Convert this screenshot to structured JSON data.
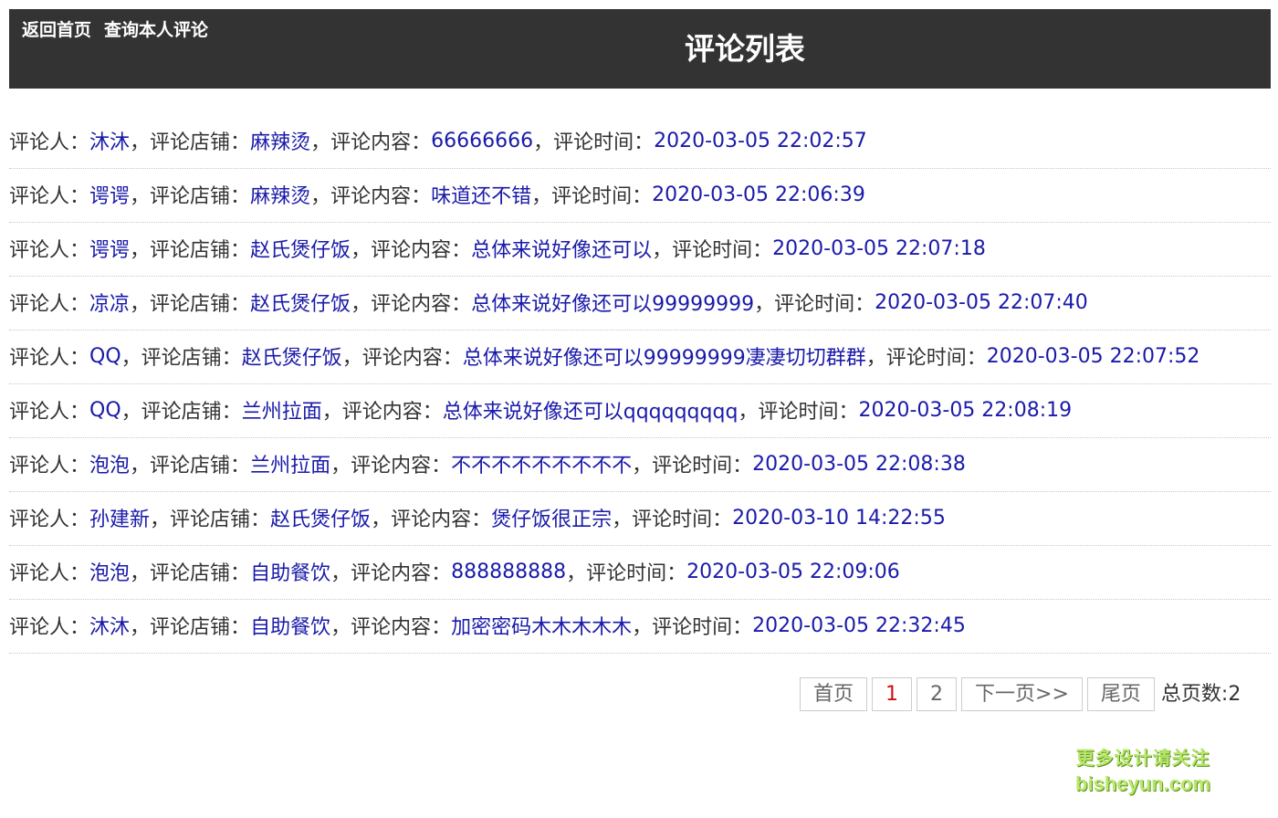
{
  "nav": {
    "home": "返回首页",
    "my_comments": "查询本人评论"
  },
  "title": "评论列表",
  "labels": {
    "commenter": "评论人：",
    "shop": "评论店铺：",
    "content": "评论内容：",
    "time": "评论时间：",
    "comma": "，"
  },
  "comments": [
    {
      "user": "沐沐",
      "shop": "麻辣烫",
      "content": "66666666",
      "time": "2020-03-05 22:02:57"
    },
    {
      "user": "谔谔",
      "shop": "麻辣烫",
      "content": "味道还不错",
      "time": "2020-03-05 22:06:39"
    },
    {
      "user": "谔谔",
      "shop": "赵氏煲仔饭",
      "content": "总体来说好像还可以",
      "time": "2020-03-05 22:07:18"
    },
    {
      "user": "凉凉",
      "shop": "赵氏煲仔饭",
      "content": "总体来说好像还可以99999999",
      "time": "2020-03-05 22:07:40"
    },
    {
      "user": "QQ",
      "shop": "赵氏煲仔饭",
      "content": "总体来说好像还可以99999999凄凄切切群群",
      "time": "2020-03-05 22:07:52"
    },
    {
      "user": "QQ",
      "shop": "兰州拉面",
      "content": "总体来说好像还可以qqqqqqqqq",
      "time": "2020-03-05 22:08:19"
    },
    {
      "user": "泡泡",
      "shop": "兰州拉面",
      "content": "不不不不不不不不不",
      "time": "2020-03-05 22:08:38"
    },
    {
      "user": "孙建新",
      "shop": "赵氏煲仔饭",
      "content": "煲仔饭很正宗",
      "time": "2020-03-10 14:22:55"
    },
    {
      "user": "泡泡",
      "shop": "自助餐饮",
      "content": "888888888",
      "time": "2020-03-05 22:09:06"
    },
    {
      "user": "沐沐",
      "shop": "自助餐饮",
      "content": "加密密码木木木木木",
      "time": "2020-03-05 22:32:45"
    }
  ],
  "pager": {
    "first": "首页",
    "pages": [
      "1",
      "2"
    ],
    "current": "1",
    "next": "下一页>>",
    "last": "尾页",
    "total_label": "总页数:2"
  },
  "watermark": {
    "line1": "更多设计请关注",
    "line2": "bisheyun.com"
  },
  "colors": {
    "header_bg": "#333333",
    "link": "#1a1aaa",
    "current_page": "#d01010"
  }
}
